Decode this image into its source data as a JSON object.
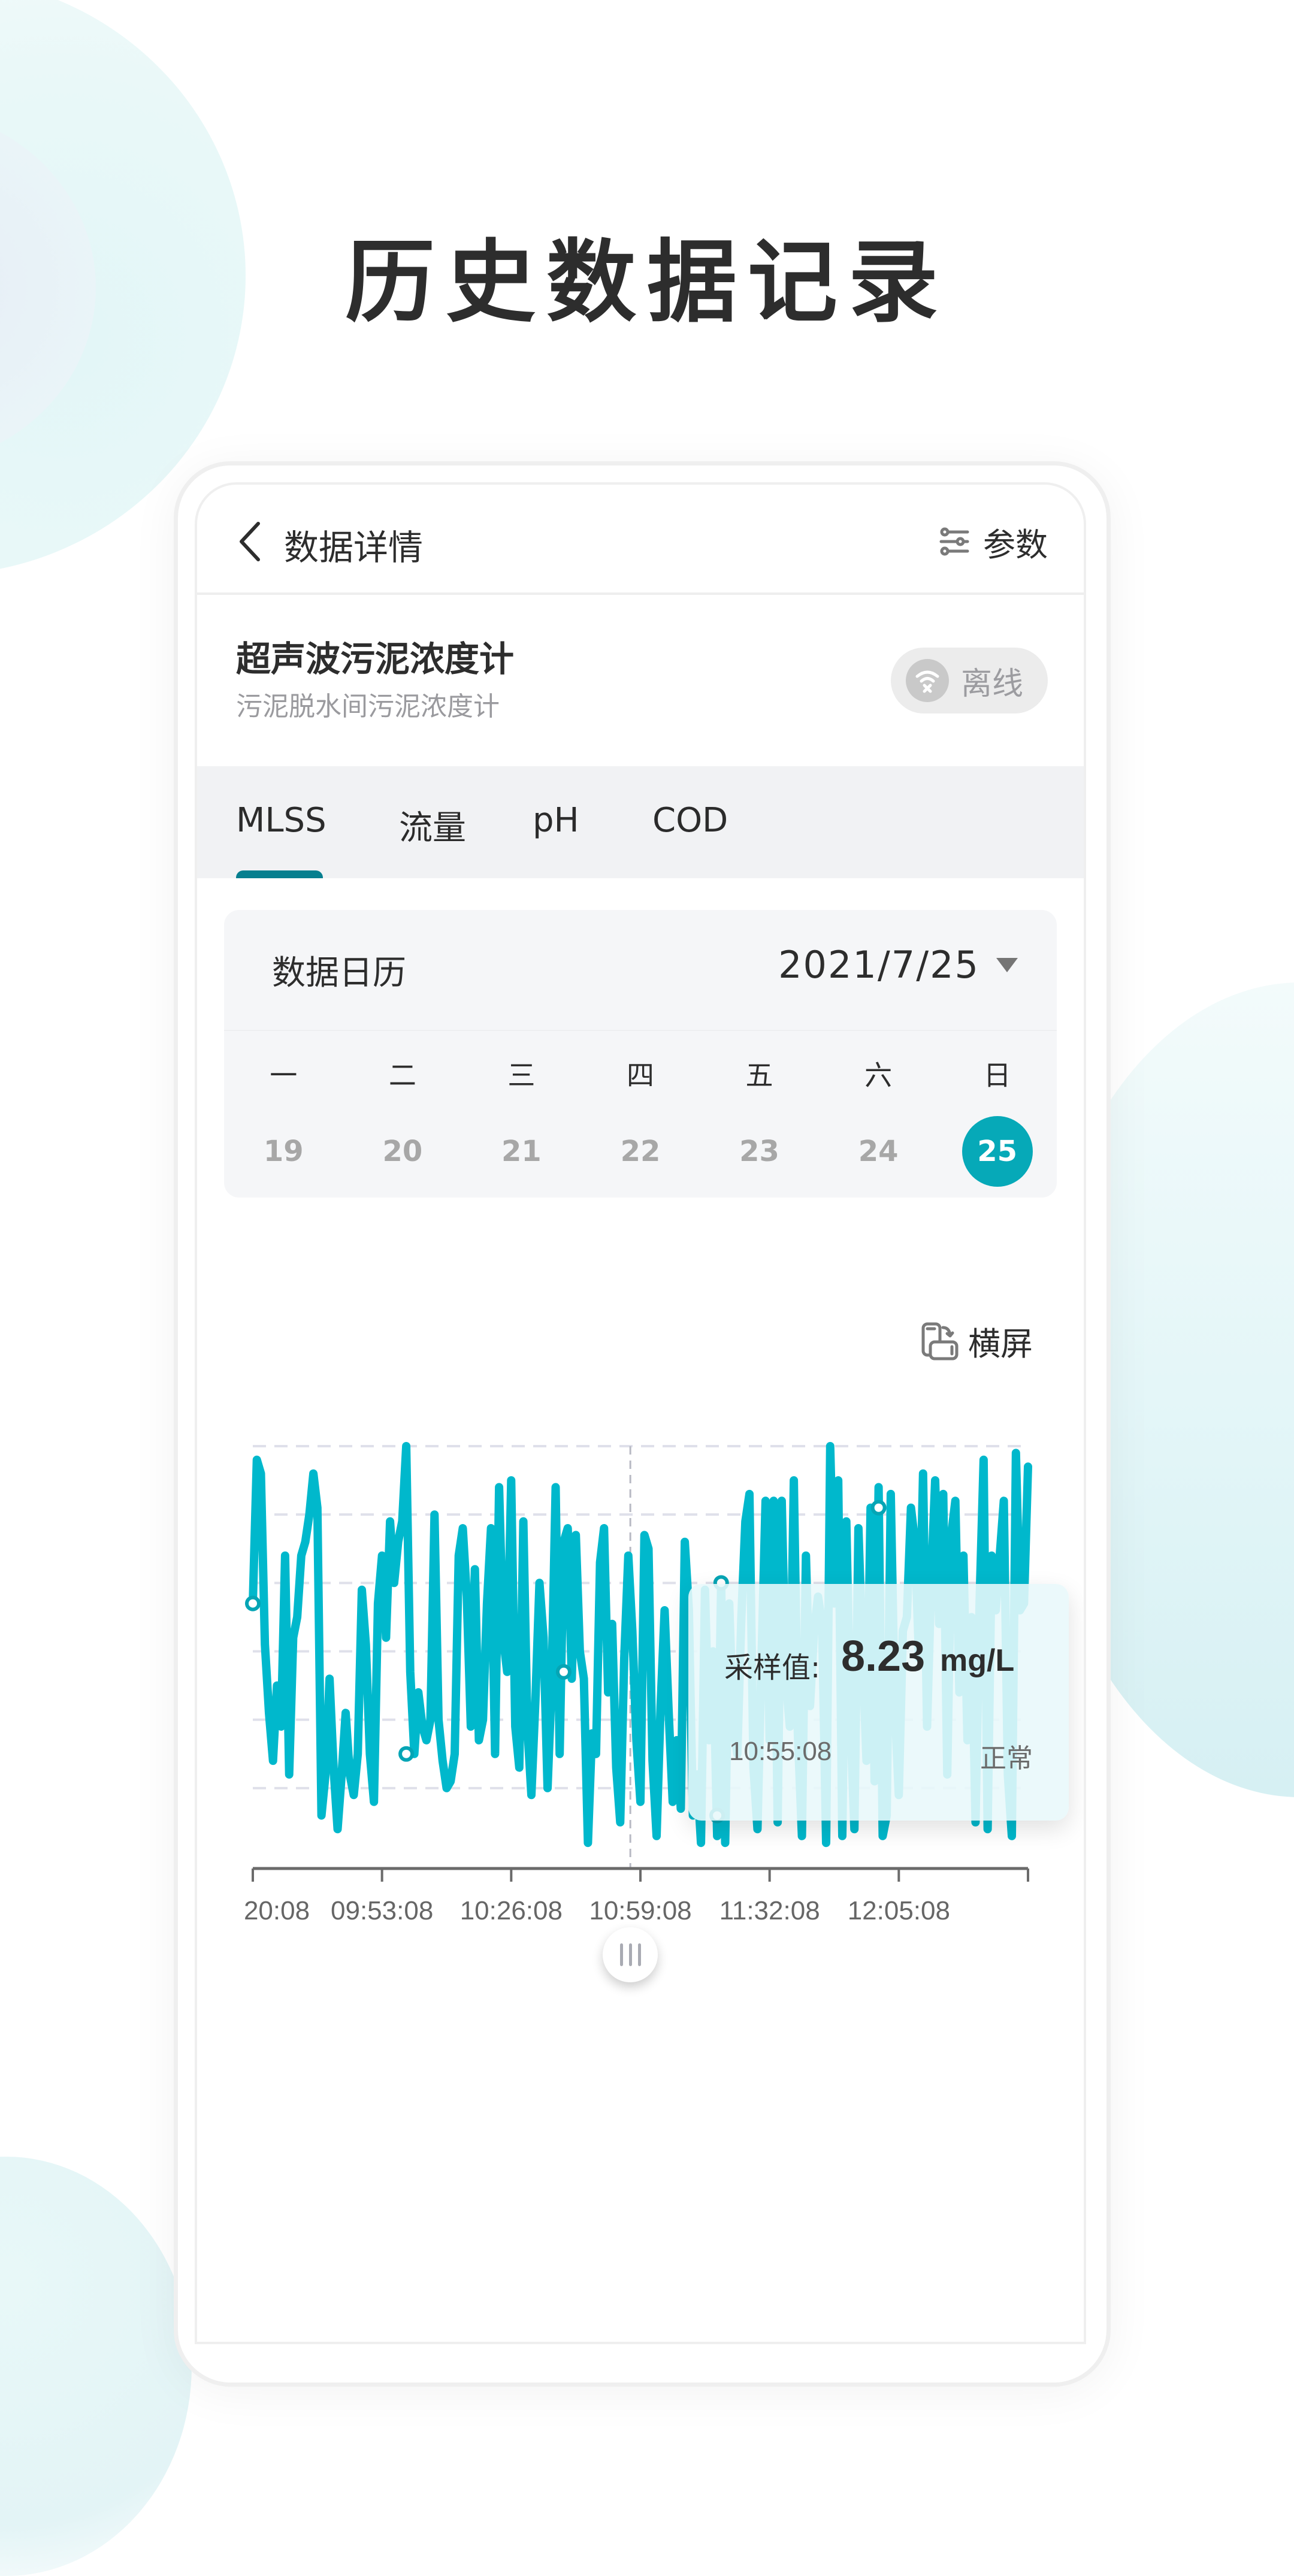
{
  "hero": {
    "title": "历史数据记录"
  },
  "header": {
    "title": "数据详情",
    "back_icon": "chevron-left-icon",
    "params_label": "参数",
    "params_icon": "sliders-icon"
  },
  "device": {
    "name": "超声波污泥浓度计",
    "subtitle": "污泥脱水间污泥浓度计",
    "status": "离线",
    "status_icon": "wifi-off-icon"
  },
  "tabs": [
    {
      "label": "MLSS",
      "active": true
    },
    {
      "label": "流量",
      "active": false
    },
    {
      "label": "pH",
      "active": false
    },
    {
      "label": "COD",
      "active": false
    }
  ],
  "calendar": {
    "title": "数据日历",
    "selected_date": "2021/7/25",
    "weekdays": [
      "一",
      "二",
      "三",
      "四",
      "五",
      "六",
      "日"
    ],
    "days": [
      "19",
      "20",
      "21",
      "22",
      "23",
      "24",
      "25"
    ],
    "selected_day": "25"
  },
  "landscape": {
    "label": "横屏",
    "icon": "rotate-screen-icon"
  },
  "tooltip": {
    "label": "采样值:",
    "value": "8.23",
    "unit": "mg/L",
    "time": "10:55:08",
    "status": "正常"
  },
  "colors": {
    "accent": "#06a9b8",
    "line": "#00b8cc",
    "tab_underline": "#067f8f",
    "offline_gray": "#c9c9c9"
  },
  "chart_data": {
    "type": "line",
    "title": "",
    "xlabel": "",
    "ylabel": "",
    "x_tick_labels": [
      "20:08",
      "09:53:08",
      "10:26:08",
      "10:59:08",
      "11:32:08",
      "12:05:08",
      ""
    ],
    "ylim": [
      0,
      6
    ],
    "grid": true,
    "grid_lines": 6,
    "cursor_x_fraction": 0.487,
    "series": [
      {
        "name": "MLSS",
        "values": [
          3.7,
          5.8,
          5.6,
          3.1,
          2.1,
          1.4,
          2.5,
          1.9,
          4.4,
          1.2,
          3.2,
          3.5,
          4.4,
          4.6,
          5.0,
          5.6,
          5.1,
          0.6,
          1.2,
          2.6,
          1.3,
          0.4,
          1.2,
          2.1,
          1.2,
          0.9,
          1.5,
          3.9,
          3.1,
          1.5,
          0.8,
          3.7,
          4.4,
          3.2,
          4.9,
          4.0,
          4.6,
          4.9,
          6.0,
          2.7,
          1.5,
          2.4,
          1.9,
          1.7,
          2.0,
          5.0,
          2.0,
          1.4,
          1.0,
          1.1,
          1.5,
          4.4,
          4.8,
          3.8,
          1.9,
          4.2,
          1.7,
          2.0,
          3.7,
          4.8,
          1.5,
          5.4,
          3.2,
          2.7,
          5.5,
          1.9,
          1.3,
          4.9,
          1.9,
          0.9,
          2.3,
          4.0,
          3.2,
          1.0,
          2.5,
          5.4,
          1.5,
          4.6,
          4.8,
          2.6,
          4.7,
          3.0,
          2.6,
          0.2,
          1.8,
          1.5,
          4.3,
          4.8,
          2.4,
          3.4,
          1.3,
          0.5,
          2.9,
          4.4,
          3.3,
          1.7,
          0.8,
          4.7,
          4.5,
          1.4,
          0.3,
          2.2,
          3.6,
          2.1,
          0.8,
          1.7,
          0.7,
          4.6,
          3.6,
          0.6,
          1.2,
          0.2,
          3.9,
          1.7,
          3.0,
          0.3,
          4.0,
          0.2,
          3.7,
          1.9,
          1.5,
          3.5,
          4.9,
          5.3,
          1.3,
          0.4,
          2.9,
          5.2,
          1.7,
          5.2,
          0.5,
          5.2,
          2.6,
          1.9,
          5.5,
          1.8,
          0.3,
          4.4,
          2.2,
          3.3,
          3.8,
          3.4,
          0.2,
          6.0,
          3.7,
          5.5,
          0.3,
          4.9,
          2.0,
          0.4,
          4.8,
          3.0,
          1.4,
          5.1,
          1.1,
          5.4,
          0.3,
          0.6,
          5.3,
          2.2,
          0.9,
          3.3,
          3.5,
          5.1,
          4.6,
          2.9,
          5.6,
          1.9,
          4.0,
          5.5,
          3.4,
          5.3,
          1.2,
          4.7,
          5.2,
          2.4,
          4.4,
          1.7,
          3.5,
          0.5,
          3.7,
          5.8,
          0.4,
          4.4,
          3.6,
          4.4,
          5.2,
          1.2,
          0.3,
          5.9,
          3.6,
          3.7,
          5.7
        ]
      }
    ],
    "markers": [
      {
        "index": 0,
        "value": 3.7
      },
      {
        "index": 38,
        "value": 1.5
      },
      {
        "index": 77,
        "value": 2.7
      },
      {
        "index": 115,
        "value": 0.6
      },
      {
        "index": 116,
        "value": 4.0
      },
      {
        "index": 155,
        "value": 5.1
      }
    ]
  }
}
